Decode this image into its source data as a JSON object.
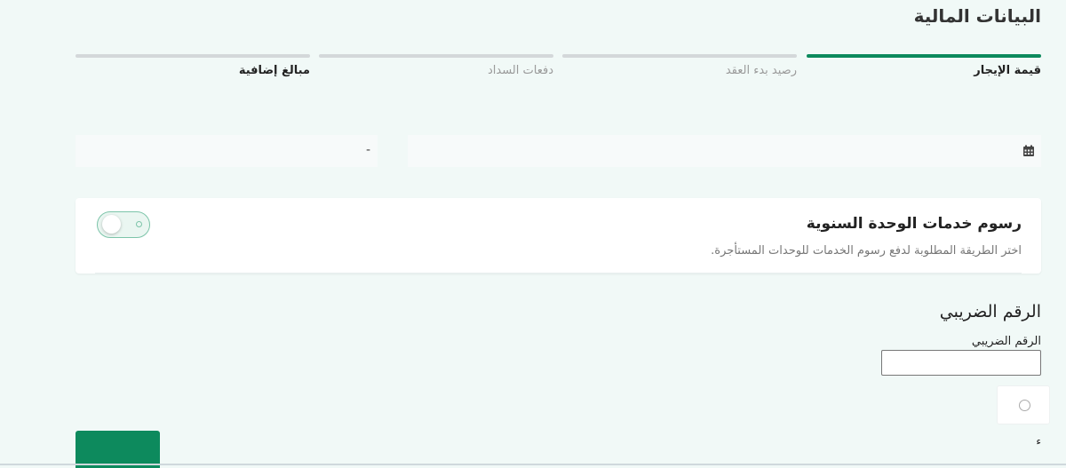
{
  "page": {
    "title": "البيانات المالية"
  },
  "stepper": {
    "steps": [
      {
        "label": "قيمة الإيجار"
      },
      {
        "label": "رصيد بدء العقد"
      },
      {
        "label": "دفعات السداد"
      },
      {
        "label": "مبالغ إضافية"
      }
    ]
  },
  "fields": {
    "range_separator": "-",
    "date_icon": "calendar-icon"
  },
  "service_fees": {
    "title": "رسوم خدمات الوحدة السنوية",
    "description": "اختر الطريقة المطلوبة لدفع رسوم الخدمات للوحدات المستأجرة.",
    "toggle_on": false
  },
  "tax": {
    "section_title": "الرقم الضريبي",
    "field_label": "الرقم الضريبي",
    "value": ""
  },
  "misc": {
    "small_char": "ء"
  },
  "colors": {
    "accent": "#0d8a5d",
    "background": "#f1f9f7"
  }
}
